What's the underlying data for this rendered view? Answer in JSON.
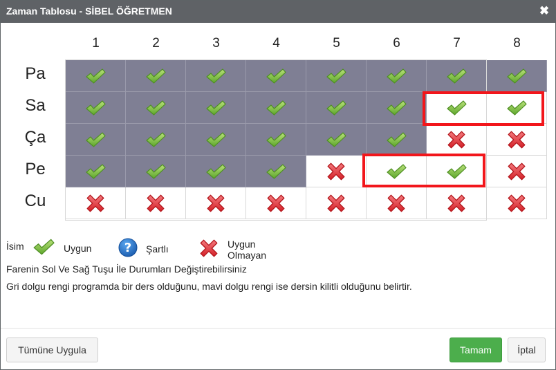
{
  "dialog": {
    "title": "Zaman Tablosu - SİBEL ÖĞRETMEN",
    "close_label": "✖"
  },
  "timetable": {
    "periods": [
      "1",
      "2",
      "3",
      "4",
      "5",
      "6",
      "7",
      "8"
    ],
    "days": [
      "Pa",
      "Sa",
      "Ça",
      "Pe",
      "Cu"
    ],
    "rows": [
      {
        "day": "Pa",
        "cells": [
          "busy-available",
          "busy-available",
          "busy-available",
          "busy-available",
          "busy-available",
          "busy-available",
          "busy-available",
          "busy-available"
        ]
      },
      {
        "day": "Sa",
        "cells": [
          "busy-available",
          "busy-available",
          "busy-available",
          "busy-available",
          "busy-available",
          "busy-available",
          "available",
          "available"
        ]
      },
      {
        "day": "Ça",
        "cells": [
          "busy-available",
          "busy-available",
          "busy-available",
          "busy-available",
          "busy-available",
          "busy-available",
          "unavailable",
          "unavailable"
        ]
      },
      {
        "day": "Pe",
        "cells": [
          "busy-available",
          "busy-available",
          "busy-available",
          "busy-available",
          "unavailable",
          "available",
          "available",
          "unavailable"
        ]
      },
      {
        "day": "Cu",
        "cells": [
          "unavailable",
          "unavailable",
          "unavailable",
          "unavailable",
          "unavailable",
          "unavailable",
          "unavailable",
          "unavailable"
        ]
      }
    ],
    "highlighted": [
      {
        "day": "Sa",
        "periods": [
          "7",
          "8"
        ]
      },
      {
        "day": "Pe",
        "periods": [
          "6",
          "7"
        ]
      }
    ]
  },
  "legend": {
    "name_label": "İsim",
    "available_label": "Uygun",
    "conditional_label": "Şartlı",
    "unavailable_label": "Uygun Olmayan"
  },
  "info": {
    "line1": "Farenin Sol Ve Sağ Tuşu İle Durumları Değiştirebilirsiniz",
    "line2": "Gri dolgu rengi programda bir ders olduğunu, mavi dolgu rengi ise dersin kilitli olduğunu belirtir."
  },
  "footer": {
    "apply_all_label": "Tümüne Uygula",
    "ok_label": "Tamam",
    "cancel_label": "İptal"
  },
  "colors": {
    "titlebar": "#5f6266",
    "busy_cell": "#7f7f94",
    "check_green": "#7cc241",
    "cross_red": "#e0303a",
    "highlight_red": "#f2161b",
    "ok_button": "#4cae4c",
    "help_blue": "#1f6fc5"
  },
  "icons": {
    "available": "check-icon",
    "unavailable": "cross-icon",
    "conditional": "question-icon",
    "close": "close-icon"
  }
}
